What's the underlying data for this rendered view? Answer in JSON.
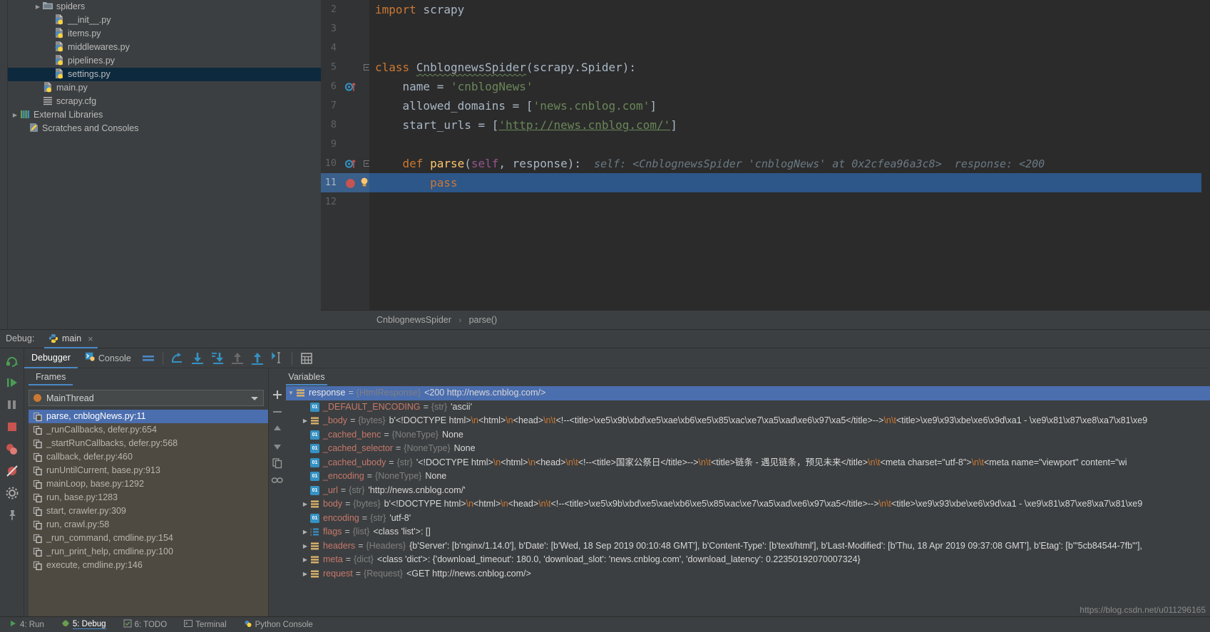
{
  "project_tree": {
    "items": [
      {
        "label": "spiders",
        "icon": "folder-icon",
        "arrow": "▶",
        "indent": 36,
        "selected": false
      },
      {
        "label": "__init__.py",
        "icon": "python-file-icon",
        "arrow": "",
        "indent": 52,
        "selected": false
      },
      {
        "label": "items.py",
        "icon": "python-file-icon",
        "arrow": "",
        "indent": 52,
        "selected": false
      },
      {
        "label": "middlewares.py",
        "icon": "python-file-icon",
        "arrow": "",
        "indent": 52,
        "selected": false
      },
      {
        "label": "pipelines.py",
        "icon": "python-file-icon",
        "arrow": "",
        "indent": 52,
        "selected": false
      },
      {
        "label": "settings.py",
        "icon": "python-file-icon",
        "arrow": "",
        "indent": 52,
        "selected": true
      },
      {
        "label": "main.py",
        "icon": "python-file-icon",
        "arrow": "",
        "indent": 36,
        "selected": false
      },
      {
        "label": "scrapy.cfg",
        "icon": "config-file-icon",
        "arrow": "",
        "indent": 36,
        "selected": false
      },
      {
        "label": "External Libraries",
        "icon": "libraries-icon",
        "arrow": "▶",
        "indent": 4,
        "selected": false
      },
      {
        "label": "Scratches and Consoles",
        "icon": "scratches-icon",
        "arrow": "",
        "indent": 16,
        "selected": false
      }
    ]
  },
  "editor": {
    "lines": [
      {
        "num": "2",
        "marker": "",
        "current": false,
        "fold": false,
        "tokens": [
          {
            "t": "import ",
            "c": "kw"
          },
          {
            "t": "scrapy",
            "c": "plain"
          }
        ]
      },
      {
        "num": "3",
        "marker": "",
        "current": false,
        "fold": false,
        "tokens": []
      },
      {
        "num": "4",
        "marker": "",
        "current": false,
        "fold": false,
        "tokens": []
      },
      {
        "num": "5",
        "marker": "",
        "current": false,
        "fold": true,
        "tokens": [
          {
            "t": "class ",
            "c": "kw"
          },
          {
            "t": "CnblognewsSpider",
            "c": "squig"
          },
          {
            "t": "(scrapy.Spider):",
            "c": "plain"
          }
        ]
      },
      {
        "num": "6",
        "marker": "breakpoint-hit-icon",
        "current": false,
        "fold": false,
        "tokens": [
          {
            "t": "    name = ",
            "c": "plain"
          },
          {
            "t": "'cnblogNews'",
            "c": "str"
          }
        ]
      },
      {
        "num": "7",
        "marker": "",
        "current": false,
        "fold": false,
        "tokens": [
          {
            "t": "    allowed_domains = [",
            "c": "plain"
          },
          {
            "t": "'news.cnblog.com'",
            "c": "str"
          },
          {
            "t": "]",
            "c": "plain"
          }
        ]
      },
      {
        "num": "8",
        "marker": "",
        "current": false,
        "fold": false,
        "tokens": [
          {
            "t": "    start_urls = [",
            "c": "plain"
          },
          {
            "t": "'http://news.cnblog.com/'",
            "c": "strlink"
          },
          {
            "t": "]",
            "c": "plain"
          }
        ]
      },
      {
        "num": "9",
        "marker": "",
        "current": false,
        "fold": false,
        "tokens": []
      },
      {
        "num": "10",
        "marker": "method-override-icon",
        "current": false,
        "fold": true,
        "tokens": [
          {
            "t": "    ",
            "c": "plain"
          },
          {
            "t": "def ",
            "c": "kw"
          },
          {
            "t": "parse",
            "c": "fn"
          },
          {
            "t": "(",
            "c": "plain"
          },
          {
            "t": "self",
            "c": "self"
          },
          {
            "t": ", response):",
            "c": "plain"
          },
          {
            "t": "  self: <CnblognewsSpider 'cnblogNews' at 0x2cfea96a3c8>  response: <200",
            "c": "hint"
          }
        ]
      },
      {
        "num": "11",
        "marker": "breakpoint-icon",
        "current": true,
        "fold": false,
        "tokens": [
          {
            "t": "        pass",
            "c": "kw"
          }
        ]
      },
      {
        "num": "12",
        "marker": "",
        "current": false,
        "fold": false,
        "tokens": []
      }
    ],
    "breadcrumb": {
      "class_name": "CnblognewsSpider",
      "separator": "›",
      "method_name": "parse()"
    }
  },
  "debug": {
    "label": "Debug:",
    "tab_name": "main",
    "tab_close": "×",
    "tabs": [
      {
        "label": "Debugger",
        "icon": "debugger-icon",
        "active": true
      },
      {
        "label": "Console",
        "icon": "console-icon",
        "active": false
      }
    ],
    "toolbar_icons": [
      "show-hide-icon",
      "step-over-icon",
      "step-into-icon",
      "force-step-into-icon",
      "step-out-icon",
      "run-to-cursor-icon",
      "evaluate-icon"
    ],
    "side_icons": [
      "rerun-icon",
      "resume-icon",
      "pause-icon",
      "stop-icon",
      "view-breakpoints-icon",
      "mute-breakpoints-icon",
      "settings-icon",
      "pin-icon"
    ],
    "frames": {
      "header": "Frames",
      "thread": "MainThread",
      "items": [
        {
          "label": "parse, cnblogNews.py:11",
          "selected": true
        },
        {
          "label": "_runCallbacks, defer.py:654",
          "selected": false
        },
        {
          "label": "_startRunCallbacks, defer.py:568",
          "selected": false
        },
        {
          "label": "callback, defer.py:460",
          "selected": false
        },
        {
          "label": "runUntilCurrent, base.py:913",
          "selected": false
        },
        {
          "label": "mainLoop, base.py:1292",
          "selected": false
        },
        {
          "label": "run, base.py:1283",
          "selected": false
        },
        {
          "label": "start, crawler.py:309",
          "selected": false
        },
        {
          "label": "run, crawl.py:58",
          "selected": false
        },
        {
          "label": "_run_command, cmdline.py:154",
          "selected": false
        },
        {
          "label": "_run_print_help, cmdline.py:100",
          "selected": false
        },
        {
          "label": "execute, cmdline.py:146",
          "selected": false
        }
      ]
    },
    "variables": {
      "header": "Variables",
      "items": [
        {
          "expand": "▼",
          "indent": 0,
          "icon": "object-icon",
          "name": "response",
          "type": "{HtmlResponse}",
          "value": "<200 http://news.cnblog.com/>",
          "selected": true
        },
        {
          "expand": "",
          "indent": 20,
          "icon": "str-icon",
          "name": "_DEFAULT_ENCODING",
          "type": "{str}",
          "value": "'ascii'",
          "selected": false
        },
        {
          "expand": "▶",
          "indent": 20,
          "icon": "object-icon",
          "name": "_body",
          "type": "{bytes}",
          "value": "b'<!DOCTYPE html>\\n<html>\\n<head>\\n\\t<!--<title>\\xe5\\x9b\\xbd\\xe5\\xae\\xb6\\xe5\\x85\\xac\\xe7\\xa5\\xad\\xe6\\x97\\xa5</title>-->\\n\\t<title>\\xe9\\x93\\xbe\\xe6\\x9d\\xa1 - \\xe9\\x81\\x87\\xe8\\xa7\\x81\\xe9",
          "selected": false
        },
        {
          "expand": "",
          "indent": 20,
          "icon": "str-icon",
          "name": "_cached_benc",
          "type": "{NoneType}",
          "value": "None",
          "selected": false
        },
        {
          "expand": "",
          "indent": 20,
          "icon": "str-icon",
          "name": "_cached_selector",
          "type": "{NoneType}",
          "value": "None",
          "selected": false
        },
        {
          "expand": "",
          "indent": 20,
          "icon": "str-icon",
          "name": "_cached_ubody",
          "type": "{str}",
          "value": "'<!DOCTYPE html>\\n<html>\\n<head>\\n\\t<!--<title>国家公祭日</title>-->\\n\\t<title>链条 - 遇见链条，预见未来</title>\\n\\t<meta charset=\"utf-8\">\\n\\t<meta name=\"viewport\" content=\"wi",
          "selected": false
        },
        {
          "expand": "",
          "indent": 20,
          "icon": "str-icon",
          "name": "_encoding",
          "type": "{NoneType}",
          "value": "None",
          "selected": false
        },
        {
          "expand": "",
          "indent": 20,
          "icon": "str-icon",
          "name": "_url",
          "type": "{str}",
          "value": "'http://news.cnblog.com/'",
          "selected": false
        },
        {
          "expand": "▶",
          "indent": 20,
          "icon": "object-icon",
          "name": "body",
          "type": "{bytes}",
          "value": "b'<!DOCTYPE html>\\n<html>\\n<head>\\n\\t<!--<title>\\xe5\\x9b\\xbd\\xe5\\xae\\xb6\\xe5\\x85\\xac\\xe7\\xa5\\xad\\xe6\\x97\\xa5</title>-->\\n\\t<title>\\xe9\\x93\\xbe\\xe6\\x9d\\xa1 - \\xe9\\x81\\x87\\xe8\\xa7\\x81\\xe9",
          "selected": false
        },
        {
          "expand": "",
          "indent": 20,
          "icon": "str-icon",
          "name": "encoding",
          "type": "{str}",
          "value": "'utf-8'",
          "selected": false
        },
        {
          "expand": "▶",
          "indent": 20,
          "icon": "list-icon",
          "name": "flags",
          "type": "{list}",
          "value": "<class 'list'>: []",
          "selected": false
        },
        {
          "expand": "▶",
          "indent": 20,
          "icon": "object-icon",
          "name": "headers",
          "type": "{Headers}",
          "value": "{b'Server': [b'nginx/1.14.0'], b'Date': [b'Wed, 18 Sep 2019 00:10:48 GMT'], b'Content-Type': [b'text/html'], b'Last-Modified': [b'Thu, 18 Apr 2019 09:37:08 GMT'], b'Etag': [b'\"5cb84544-7fb\"'],",
          "selected": false
        },
        {
          "expand": "▶",
          "indent": 20,
          "icon": "object-icon",
          "name": "meta",
          "type": "{dict}",
          "value": "<class 'dict'>: {'download_timeout': 180.0, 'download_slot': 'news.cnblog.com', 'download_latency': 0.22350192070007324}",
          "selected": false
        },
        {
          "expand": "▶",
          "indent": 20,
          "icon": "object-icon",
          "name": "request",
          "type": "{Request}",
          "value": "<GET http://news.cnblog.com/>",
          "selected": false
        }
      ]
    }
  },
  "status_bar": {
    "items": [
      {
        "label": "4: Run",
        "icon": "run-icon"
      },
      {
        "label": "5: Debug",
        "icon": "debug-icon",
        "active": true
      },
      {
        "label": "6: TODO",
        "icon": "todo-icon"
      },
      {
        "label": "Terminal",
        "icon": "terminal-icon"
      },
      {
        "label": "Python Console",
        "icon": "python-console-icon"
      }
    ]
  },
  "watermark": "https://blog.csdn.net/u011296165",
  "colors": {
    "accent": "#4a88c7",
    "selection": "#4b6eaf",
    "editor_bg": "#2b2b2b",
    "panel_bg": "#3c3f41",
    "frames_bg": "#4e4a41",
    "string_green": "#6a8759",
    "keyword_orange": "#cc7832",
    "function_yellow": "#ffc66d",
    "varname_red": "#c7786b"
  }
}
